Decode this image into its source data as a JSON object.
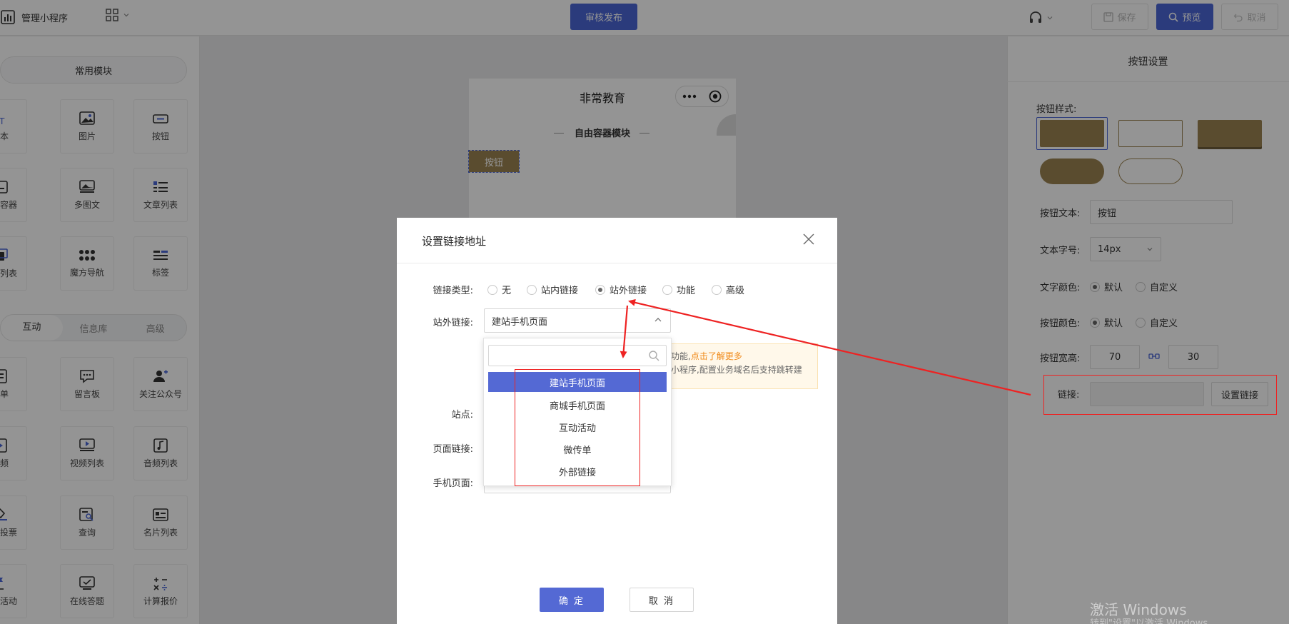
{
  "topbar": {
    "app_title": "管理小程序",
    "publish_label": "审核发布",
    "save_label": "保存",
    "preview_label": "预览",
    "undo_label": "取消"
  },
  "left_panel": {
    "common_section": "常用模块",
    "common_items": [
      "文本",
      "图片",
      "按钮",
      "自由容器",
      "多图文",
      "文章列表",
      "服务列表",
      "魔方导航",
      "标签"
    ],
    "tabs": [
      "互动",
      "信息库",
      "高级"
    ],
    "active_tab": "互动",
    "interact_items": [
      "表单",
      "留言板",
      "关注公众号",
      "视频",
      "视频列表",
      "音频列表",
      "在线投票",
      "查询",
      "名片列表",
      "打卡活动",
      "在线答题",
      "计算报价"
    ]
  },
  "phone": {
    "title": "非常教育",
    "section_title": "自由容器模块",
    "button_text": "按钮"
  },
  "right_panel": {
    "title": "按钮设置",
    "style_label": "按钮样式:",
    "text_label": "按钮文本:",
    "text_value": "按钮",
    "font_size_label": "文本字号:",
    "font_size_value": "14px",
    "text_color_label": "文字颜色:",
    "btn_color_label": "按钮颜色:",
    "option_default": "默认",
    "option_custom": "自定义",
    "size_label": "按钮宽高:",
    "width_value": "70",
    "height_value": "30",
    "link_label": "链接:",
    "set_link_label": "设置链接",
    "accent_color": "#9c8452"
  },
  "dialog": {
    "title": "设置链接地址",
    "link_type_label": "链接类型:",
    "link_types": [
      "无",
      "站内链接",
      "站外链接",
      "功能",
      "高级"
    ],
    "selected_type": "站外链接",
    "external_label": "站外链接:",
    "external_value": "建站手机页面",
    "notice_line1_prefix": "功能,",
    "notice_link": "点击了解更多",
    "notice_line2": "小程序,配置业务域名后支持跳转建",
    "site_label": "站点:",
    "page_link_label": "页面链接:",
    "mobile_page_label": "手机页面:",
    "dropdown_options": [
      "建站手机页面",
      "商城手机页面",
      "互动活动",
      "微传单",
      "外部链接"
    ],
    "ok_label": "确 定",
    "cancel_label": "取 消"
  },
  "watermark": {
    "line1": "激活 Windows",
    "line2": "转到\"设置\"以激活 Windows"
  }
}
